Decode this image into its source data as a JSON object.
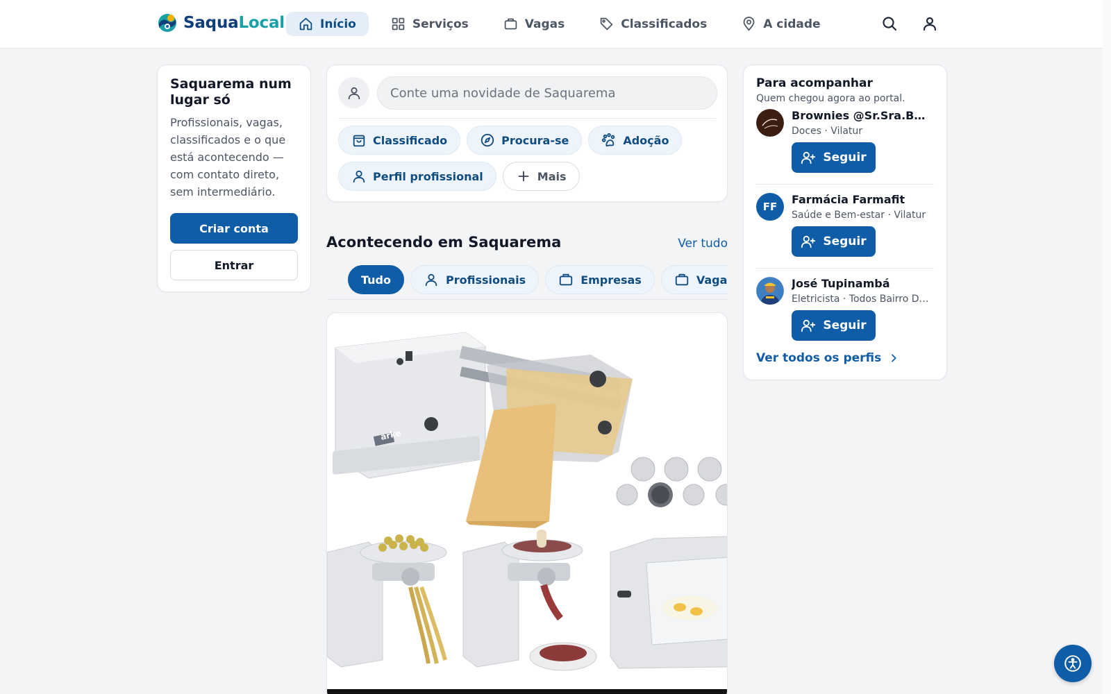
{
  "brand": {
    "name_part1": "Saqua",
    "name_part2": "Local"
  },
  "nav": [
    {
      "label": "Início",
      "icon": "home-icon",
      "active": true
    },
    {
      "label": "Serviços",
      "icon": "grid-icon"
    },
    {
      "label": "Vagas",
      "icon": "briefcase-icon"
    },
    {
      "label": "Classificados",
      "icon": "tag-icon"
    },
    {
      "label": "A cidade",
      "icon": "map-pin-icon"
    }
  ],
  "header_icons": {
    "search": "search-icon",
    "account": "user-icon"
  },
  "intro": {
    "title": "Saquarema num lugar só",
    "description": "Profissionais, vagas, classificados e o que está acontecendo — com contato direto, sem intermediário.",
    "create_account": "Criar conta",
    "login": "Entrar"
  },
  "composer": {
    "placeholder": "Conte uma novidade de Saquarema",
    "chips": [
      {
        "label": "Classificado",
        "icon": "shopping-bag-icon"
      },
      {
        "label": "Procura-se",
        "icon": "compass-icon"
      },
      {
        "label": "Adoção",
        "icon": "paw-icon"
      },
      {
        "label": "Perfil profissional",
        "icon": "user-icon"
      },
      {
        "label": "Mais",
        "icon": "plus-icon"
      }
    ]
  },
  "feed": {
    "title": "Acontecendo em Saquarema",
    "see_all": "Ver tudo",
    "tabs": [
      {
        "label": "Tudo",
        "active": true
      },
      {
        "label": "Profissionais",
        "icon": "user-icon"
      },
      {
        "label": "Empresas",
        "icon": "briefcase-icon"
      },
      {
        "label": "Vagas",
        "icon": "briefcase-icon"
      }
    ],
    "post_image_label": "arke"
  },
  "follow": {
    "title": "Para acompanhar",
    "subtitle": "Quem chegou agora ao portal.",
    "button_label": "Seguir",
    "profiles": [
      {
        "name": "Brownies @Sr.Sra.Brownies",
        "meta": "Doces · Vilatur",
        "avatar": "photo"
      },
      {
        "name": "Farmácia Farmafit",
        "meta": "Saúde e Bem-estar · Vilatur",
        "initials": "FF"
      },
      {
        "name": "José Tupinambá",
        "meta": "Eletricista · Todos Bairro De Saquarema",
        "avatar": "photo"
      }
    ],
    "see_all_profiles": "Ver todos os perfis"
  },
  "colors": {
    "primary": "#0f5da6",
    "brand_dark": "#0f3f78",
    "brand_teal": "#1aa1a8",
    "chip_bg": "#eef4fb"
  }
}
